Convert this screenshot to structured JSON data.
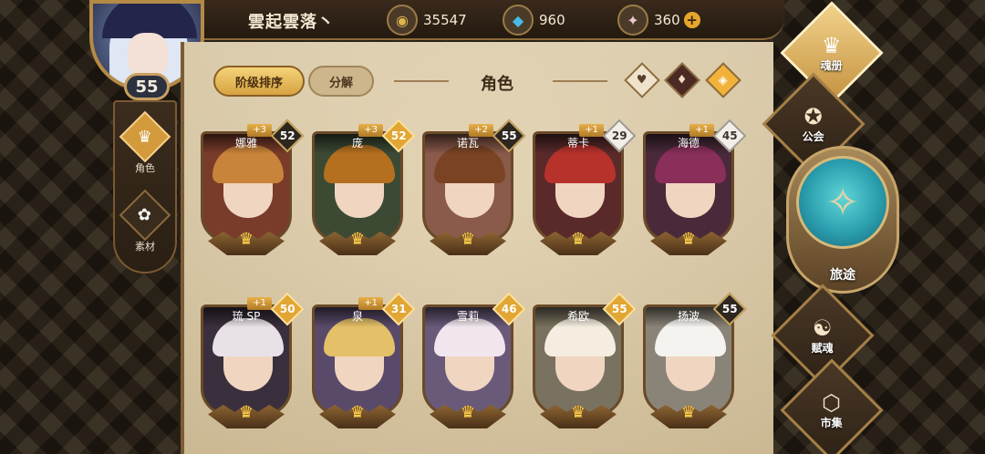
{
  "player": {
    "name": "雲起雲落丶",
    "level": "55"
  },
  "currencies": [
    {
      "icon": "gold-coin-icon",
      "glyph": "◉",
      "value": "35547",
      "color": "#e0b54d"
    },
    {
      "icon": "blue-crystal-icon",
      "glyph": "◆",
      "value": "960",
      "color": "#49b9e8"
    },
    {
      "icon": "pink-gem-icon",
      "glyph": "✦",
      "value": "360",
      "color": "#f0c6cf"
    }
  ],
  "currency_plus": "+",
  "left_nav": [
    {
      "label": "角色",
      "glyph": "♛",
      "active": true
    },
    {
      "label": "素材",
      "glyph": "✿",
      "active": false
    }
  ],
  "tabs": {
    "sort": "阶级排序",
    "dismantle": "分解"
  },
  "section_title": "角色",
  "filters": [
    {
      "name": "heart-filter-icon",
      "glyph": "♥",
      "bg": "#efe3cc",
      "color": "#5a4030"
    },
    {
      "name": "sword-filter-icon",
      "glyph": "♦",
      "bg": "#4a2a22",
      "color": "#f0dcc0"
    },
    {
      "name": "shield-filter-icon",
      "glyph": "◈",
      "bg": "#f2b23a",
      "color": "#fff"
    }
  ],
  "heroes": [
    {
      "name": "娜雅",
      "level": "52",
      "plus": "+3",
      "lvl_style": "dark",
      "hair": "#c8843a",
      "bg": "#7a3c2a"
    },
    {
      "name": "庞",
      "level": "52",
      "plus": "+3",
      "lvl_style": "gold",
      "hair": "#b5701f",
      "bg": "#3c4a34"
    },
    {
      "name": "诺瓦",
      "level": "55",
      "plus": "+2",
      "lvl_style": "dark",
      "hair": "#7a4424",
      "bg": "#8a5a4a"
    },
    {
      "name": "蒂卡",
      "level": "29",
      "plus": "+1",
      "lvl_style": "silver",
      "hair": "#b8322c",
      "bg": "#5a2a2a"
    },
    {
      "name": "海德",
      "level": "45",
      "plus": "+1",
      "lvl_style": "silver",
      "hair": "#8a2f5a",
      "bg": "#4a2a3a"
    },
    {
      "name": "琉 SP",
      "level": "50",
      "plus": "+1",
      "lvl_style": "gold",
      "hair": "#e8e2e8",
      "bg": "#3a2f3c"
    },
    {
      "name": "泉",
      "level": "31",
      "plus": "+1",
      "lvl_style": "gold",
      "hair": "#e4c068",
      "bg": "#5a4a6a"
    },
    {
      "name": "雪莉",
      "level": "46",
      "plus": "",
      "lvl_style": "gold",
      "hair": "#f1e6ee",
      "bg": "#6a5a7a"
    },
    {
      "name": "希欧",
      "level": "55",
      "plus": "",
      "lvl_style": "gold",
      "hair": "#f4ede0",
      "bg": "#7a7260"
    },
    {
      "name": "扬波",
      "level": "55",
      "plus": "",
      "lvl_style": "dark",
      "hair": "#f5f3ef",
      "bg": "#8a8478"
    }
  ],
  "right_nav": [
    {
      "label": "魂册",
      "glyph": "♛",
      "active": true,
      "name": "soul-book"
    },
    {
      "label": "公会",
      "glyph": "✪",
      "active": false,
      "name": "guild"
    },
    {
      "label": "赋魂",
      "glyph": "☯",
      "active": false,
      "name": "soul-infuse"
    },
    {
      "label": "市集",
      "glyph": "⬡",
      "active": false,
      "name": "market"
    }
  ],
  "journey": {
    "label": "旅途",
    "glyph": "✧"
  }
}
